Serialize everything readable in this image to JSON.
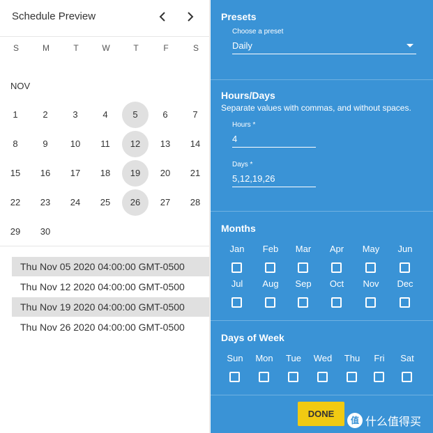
{
  "preview": {
    "title": "Schedule Preview",
    "prev_icon": "‹",
    "next_icon": "›",
    "weekdays": [
      "S",
      "M",
      "T",
      "W",
      "T",
      "F",
      "S"
    ],
    "month_label": "NOV",
    "days": [
      "1",
      "2",
      "3",
      "4",
      "5",
      "6",
      "7",
      "8",
      "9",
      "10",
      "11",
      "12",
      "13",
      "14",
      "15",
      "16",
      "17",
      "18",
      "19",
      "20",
      "21",
      "22",
      "23",
      "24",
      "25",
      "26",
      "27",
      "28",
      "29",
      "30"
    ],
    "selected_days": [
      "5",
      "12",
      "19",
      "26"
    ],
    "dates": [
      "Thu Nov 05 2020 04:00:00 GMT-0500",
      "Thu Nov 12 2020 04:00:00 GMT-0500",
      "Thu Nov 19 2020 04:00:00 GMT-0500",
      "Thu Nov 26 2020 04:00:00 GMT-0500"
    ]
  },
  "presets": {
    "heading": "Presets",
    "field_label": "Choose a preset",
    "value": "Daily"
  },
  "hours_days": {
    "heading": "Hours/Days",
    "hint": "Separate values with commas, and without spaces.",
    "hours_label": "Hours *",
    "hours_value": "4",
    "days_label": "Days *",
    "days_value": "5,12,19,26"
  },
  "months": {
    "heading": "Months",
    "items": [
      "Jan",
      "Feb",
      "Mar",
      "Apr",
      "May",
      "Jun",
      "Jul",
      "Aug",
      "Sep",
      "Oct",
      "Nov",
      "Dec"
    ]
  },
  "days_of_week": {
    "heading": "Days of Week",
    "items": [
      "Sun",
      "Mon",
      "Tue",
      "Wed",
      "Thu",
      "Fri",
      "Sat"
    ]
  },
  "done_label": "DONE",
  "watermark": {
    "logo_text": "值",
    "text": "什么值得买"
  },
  "colors": {
    "panel_bg": "#3a93d6",
    "done_bg": "#f1ca12",
    "selected_day_bg": "#e0e0e0"
  }
}
